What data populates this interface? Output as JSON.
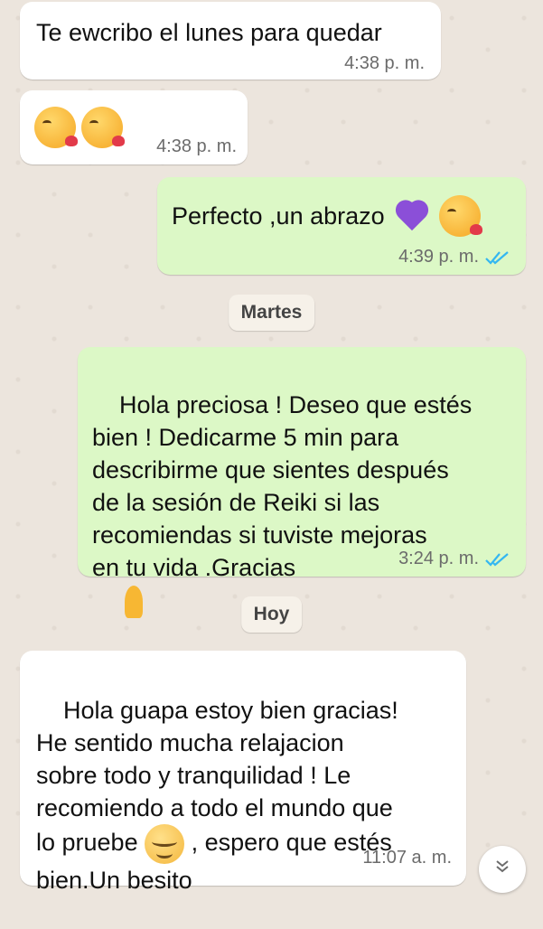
{
  "messages": [
    {
      "text": "Te ewcribo el lunes para quedar",
      "time": "4:38 p. m."
    },
    {
      "emojis": [
        "face-blowing-kiss",
        "face-blowing-kiss"
      ],
      "time": "4:38 p. m."
    },
    {
      "text": "Perfecto ,un abrazo",
      "emojis": [
        "purple-heart",
        "face-blowing-kiss"
      ],
      "time": "4:39 p. m."
    },
    {
      "date": "Martes"
    },
    {
      "text": "Hola preciosa ! Deseo que estés\nbien ! Dedicarme 5 min para\ndescribirme que sientes después\nde la sesión de Reiki si las\nrecomiendas si tuviste mejoras\nen tu vida .Gracias",
      "emojis": [
        "folded-hands"
      ],
      "time": "3:24 p. m."
    },
    {
      "date": "Hoy"
    },
    {
      "text_parts": [
        "Hola guapa estoy bien gracias!\nHe sentido mucha relajacion\nsobre todo y tranquilidad ! Le\nrecomiendo a todo el mundo que\nlo pruebe ",
        " , espero que estés\nbien.Un besito"
      ],
      "emojis": [
        "relieved-face"
      ],
      "time": "11:07 a. m."
    }
  ],
  "colors": {
    "background": "#ece5dd",
    "incoming_bubble": "#ffffff",
    "outgoing_bubble": "#dcf8c6",
    "read_ticks": "#34b7f1"
  },
  "icons": {
    "scroll_down": "double-chevron-down-icon"
  }
}
